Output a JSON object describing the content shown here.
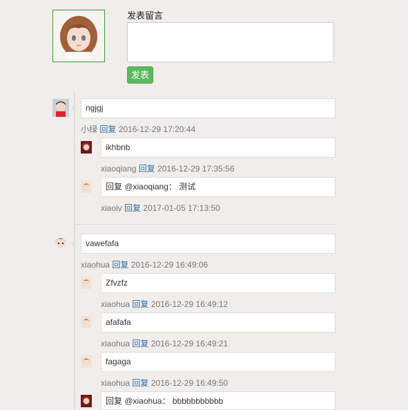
{
  "compose": {
    "title": "发表留言",
    "textarea_value": "",
    "submit_label": "发表"
  },
  "threads": [
    {
      "text": "ngjgj",
      "user": "小绿",
      "reply_label": "回复",
      "time": "2016-12-29 17:20:44",
      "replies": [
        {
          "text": "ikhbnb",
          "user": "xiaoqiang",
          "reply_label": "回复",
          "time": "2016-12-29 17:35:56"
        },
        {
          "text": "回复 @xiaoqiang： 测试",
          "user": "xiaolv",
          "reply_label": "回复",
          "time": "2017-01-05 17:13:50"
        }
      ]
    },
    {
      "text": "vawefafa",
      "user": "xiaohua",
      "reply_label": "回复",
      "time": "2016-12-29 16:49:06",
      "replies": [
        {
          "text": "Zfvzfz",
          "user": "xiaohua",
          "reply_label": "回复",
          "time": "2016-12-29 16:49:12"
        },
        {
          "text": "afafafa",
          "user": "xiaohua",
          "reply_label": "回复",
          "time": "2016-12-29 16:49:21"
        },
        {
          "text": "fagaga",
          "user": "xiaohua",
          "reply_label": "回复",
          "time": "2016-12-29 16:49:50"
        },
        {
          "text": "回复 @xiaohua： bbbbbbbbbbb",
          "user": "",
          "reply_label": "",
          "time": ""
        }
      ]
    }
  ]
}
